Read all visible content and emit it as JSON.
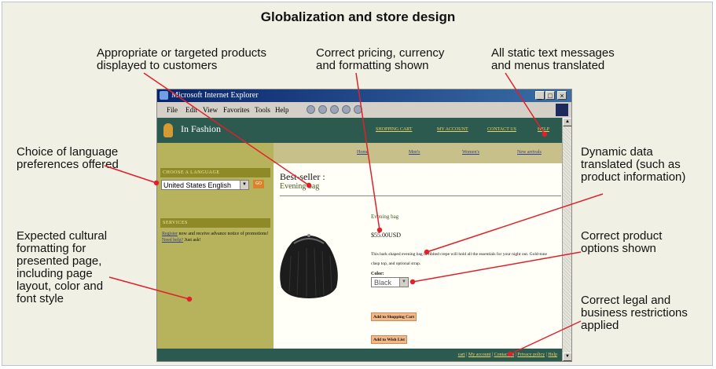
{
  "title": "Globalization and store design",
  "callouts": {
    "products": [
      "Appropriate or targeted products",
      "displayed to customers"
    ],
    "pricing": [
      "Correct pricing, currency",
      "and formatting shown"
    ],
    "static": [
      "All static text messages",
      "and menus translated"
    ],
    "language": [
      "Choice of language",
      "preferences offered"
    ],
    "dynamic": [
      "Dynamic data",
      "translated (such as",
      "product information)"
    ],
    "cultural": [
      "Expected cultural",
      "formatting for",
      "presented page,",
      "including page",
      "layout, color and",
      "font style"
    ],
    "options": [
      "Correct product",
      "options shown"
    ],
    "legal": [
      "Correct legal and",
      "business restrictions",
      "applied"
    ]
  },
  "browser": {
    "window_title": "Microsoft Internet Explorer",
    "menu": [
      "File",
      "Edit",
      "View",
      "Favorites",
      "Tools",
      "Help"
    ],
    "window_buttons": [
      "_",
      "□",
      "×"
    ]
  },
  "site": {
    "name": "In Fashion",
    "header_links": [
      "SHOPPING CART",
      "MY ACCOUNT",
      "CONTACT US",
      "HELP"
    ],
    "nav": [
      "Home",
      "Men's",
      "Women's",
      "New arrivals"
    ],
    "sidebar": {
      "language_heading": "CHOOSE A LANGUAGE",
      "language_value": "United States English",
      "go": "GO",
      "services_heading": "SERVICES",
      "register_link": "Register",
      "register_text": " now and receive advance notice of promotions!",
      "help_link": "Need help?",
      "help_text": " Just ask!"
    },
    "main": {
      "heading": "Best-seller :",
      "subheading": "Evening bag",
      "product_name": "Evening bag",
      "price": "$55.00USD",
      "description": "This bark shaped evening bag in ribbed crepe will hold all the essentials for your night out. Gold-tone clasp top, and optional strap.",
      "color_label": "Color:",
      "color_value": "Black",
      "add_to_cart": "Add to Shopping Cart",
      "add_to_wishlist": "Add to Wish List"
    },
    "footer": [
      "cart",
      "My account",
      "Contact us",
      "Privacy policy",
      "Help"
    ]
  },
  "colors": {
    "frame_bg": "#f1f0e4",
    "site_header": "#2d5a4f",
    "sidebar": "#b7b25c",
    "callout_line": "#e0202a"
  }
}
